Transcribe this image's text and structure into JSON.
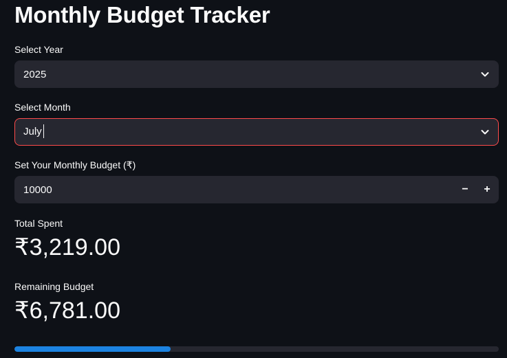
{
  "app": {
    "title": "Monthly Budget Tracker"
  },
  "year_select": {
    "label": "Select Year",
    "value": "2025",
    "icon": "chevron-down-icon"
  },
  "month_select": {
    "label": "Select Month",
    "value": "July",
    "icon": "chevron-down-icon",
    "focused": true
  },
  "budget_input": {
    "label": "Set Your Monthly Budget (₹)",
    "value": "10000",
    "decrement_label": "−",
    "increment_label": "+"
  },
  "metrics": {
    "total_spent_label": "Total Spent",
    "total_spent_value": "₹3,219.00",
    "remaining_label": "Remaining Budget",
    "remaining_value": "₹6,781.00"
  },
  "progress": {
    "fraction": 0.3219
  },
  "colors": {
    "background": "#0e1117",
    "field_background": "#262730",
    "focus_border": "#ff4b4b",
    "progress_fill": "#1c83e1"
  }
}
